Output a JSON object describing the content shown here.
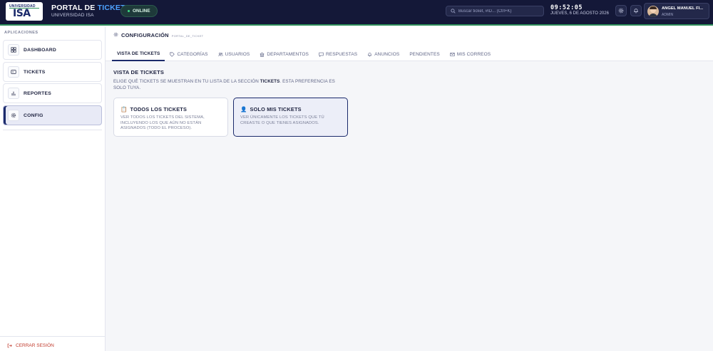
{
  "header": {
    "logo_top": "UNIVERSIDAD",
    "logo_main": "ISA",
    "title_prefix": "PORTAL DE ",
    "title_accent": "TICKETS",
    "subtitle": "UNIVERSIDAD ISA",
    "status": "ONLINE",
    "search_placeholder": "Buscar ticket, #ID... (Ctrl+K)",
    "time": "09:52:05",
    "date": "JUEVES, 6 DE AGOSTO 2026",
    "user_name": "ANGEL MANUEL FI...",
    "user_role": "ADMIN"
  },
  "sidebar": {
    "section_label": "APLICACIONES",
    "items": [
      {
        "label": "DASHBOARD",
        "icon": "grid-icon"
      },
      {
        "label": "TICKETS",
        "icon": "ticket-icon"
      },
      {
        "label": "REPORTES",
        "icon": "bar-chart-icon"
      },
      {
        "label": "CONFIG",
        "icon": "gear-icon",
        "active": true
      }
    ],
    "logout": "CERRAR SESIÓN"
  },
  "main": {
    "page_title": "CONFIGURACIÓN",
    "page_sub": "PORTAL_DE_TICKET",
    "tabs": [
      {
        "label": "VISTA DE TICKETS",
        "active": true
      },
      {
        "label": "CATEGORÍAS",
        "icon": "tag-icon"
      },
      {
        "label": "USUARIOS",
        "icon": "users-icon"
      },
      {
        "label": "DEPARTAMENTOS",
        "icon": "building-icon"
      },
      {
        "label": "RESPUESTAS",
        "icon": "message-icon"
      },
      {
        "label": "ANUNCIOS",
        "icon": "bell-icon"
      },
      {
        "label": "PENDIENTES"
      },
      {
        "label": "MIS CORREOS",
        "icon": "mail-icon"
      }
    ],
    "section_title": "VISTA DE TICKETS",
    "section_desc_pre": "ELIGE QUÉ TICKETS SE MUESTRAN EN TU LISTA DE LA SECCIÓN ",
    "section_desc_bold": "TICKETS",
    "section_desc_post": ". ESTA PREFERENCIA ES SOLO TUYA.",
    "cards": [
      {
        "emoji": "📋",
        "title": "TODOS LOS TICKETS",
        "desc": "VER TODOS LOS TICKETS DEL SISTEMA, INCLUYENDO LOS QUE AÚN NO ESTÁN ASIGNADOS (TODO EL PROCESO).",
        "selected": false
      },
      {
        "emoji": "👤",
        "title": "SOLO MIS TICKETS",
        "desc": "VER ÚNICAMENTE LOS TICKETS QUE TÚ CREASTE O QUE TIENES ASIGNADOS.",
        "selected": true
      }
    ]
  },
  "colors": {
    "header_bg": "#141838",
    "accent": "#1b2a6b",
    "title_accent": "#4ea3ff",
    "online_dot": "#3ddc84",
    "logout": "#c0392b"
  }
}
